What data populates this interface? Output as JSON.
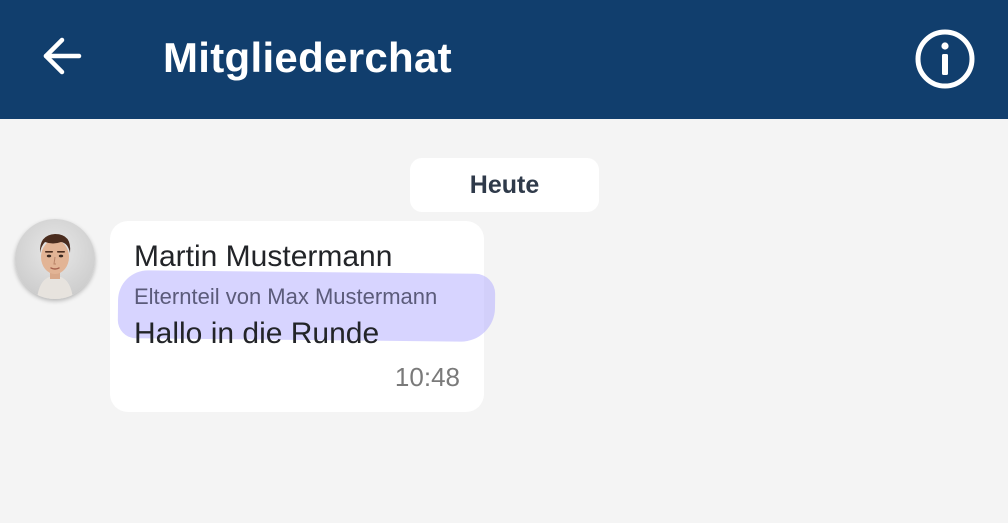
{
  "header": {
    "title": "Mitgliederchat",
    "back_icon": "arrow-left-icon",
    "info_icon": "info-circle-icon",
    "background_color": "#113e6d",
    "text_color": "#ffffff"
  },
  "chat": {
    "date_label": "Heute",
    "messages": [
      {
        "sender_name": "Martin Mustermann",
        "sender_role": "Elternteil von Max Mustermann",
        "text": "Hallo in die Runde",
        "time": "10:48",
        "avatar_icon": "user-avatar"
      }
    ],
    "highlight_color": "#b0aaff"
  }
}
